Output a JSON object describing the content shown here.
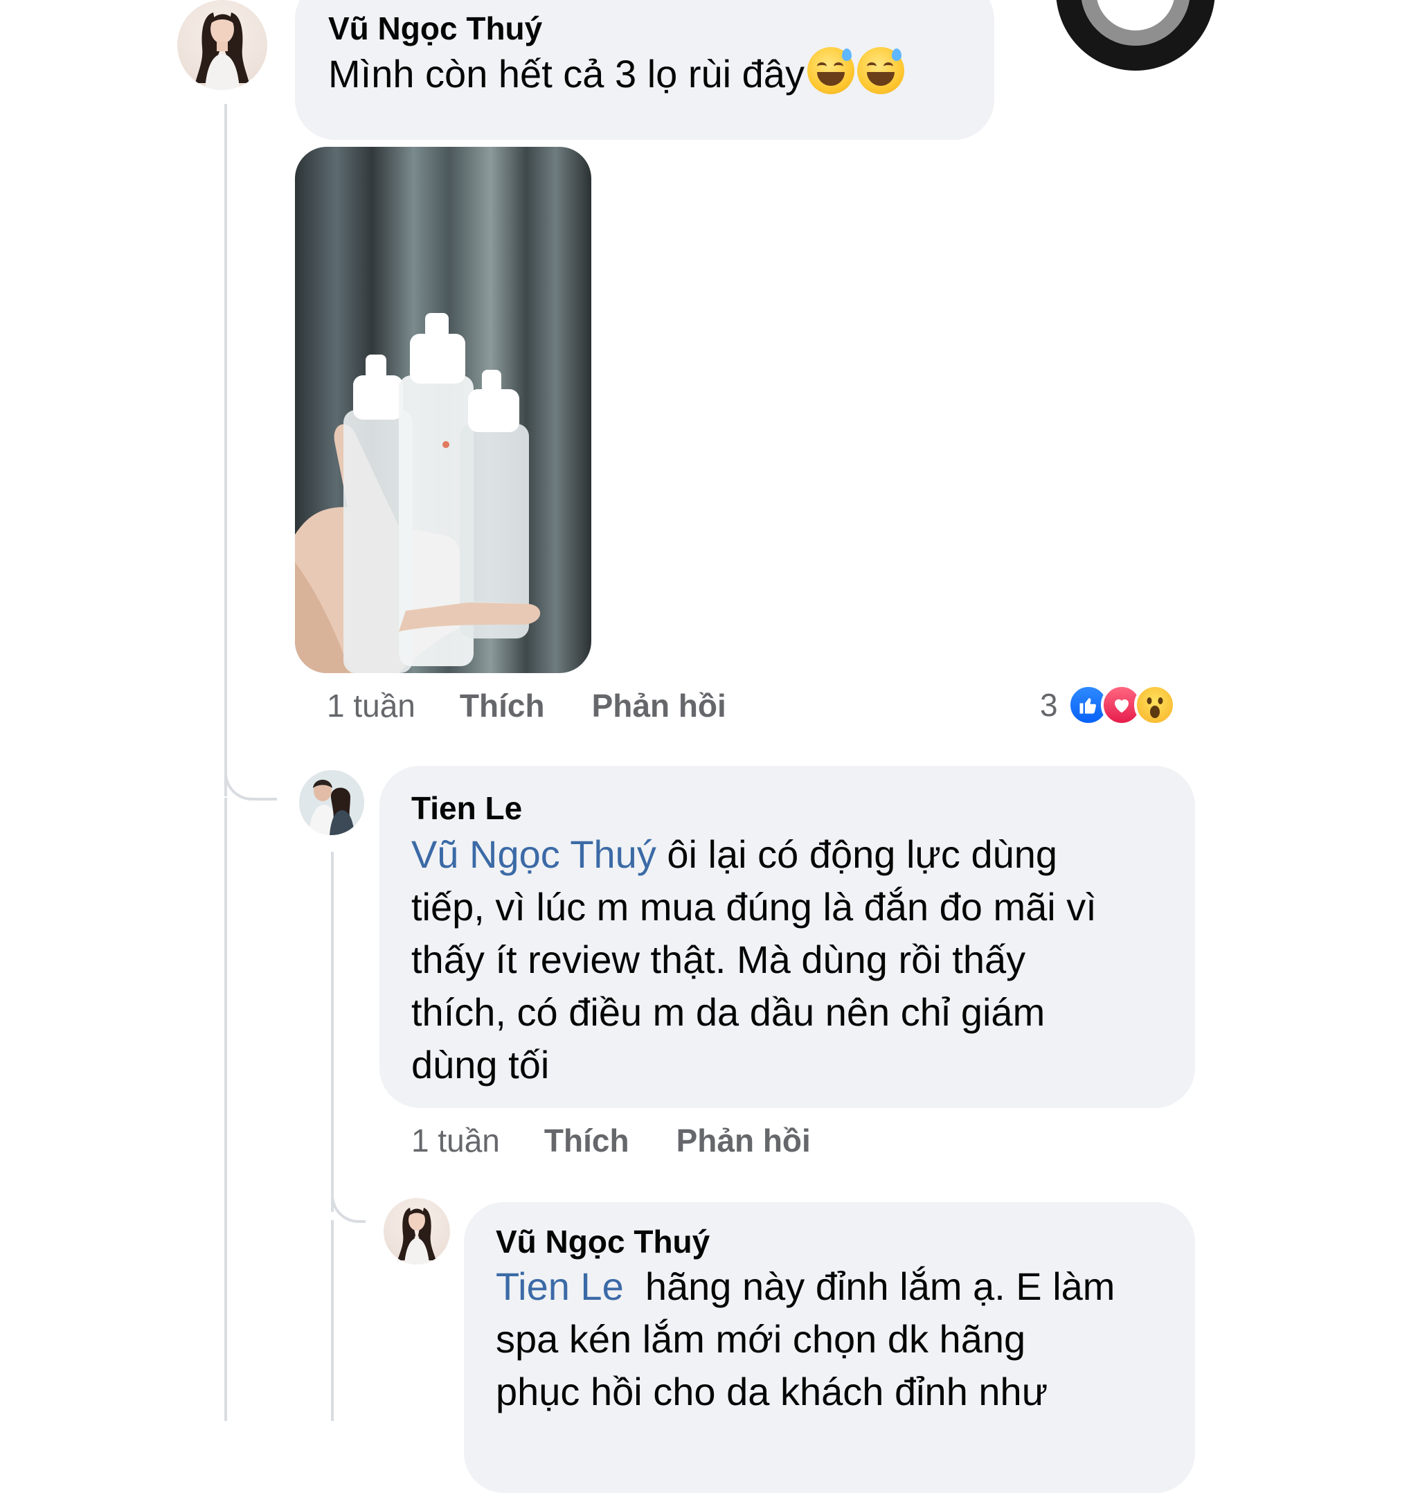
{
  "comment1": {
    "author": "Vũ Ngọc Thuý",
    "text": "Mình còn hết cả 3 lọ rùi đây",
    "emojis": [
      "grinning-sweat-emoji",
      "grinning-sweat-emoji"
    ],
    "time": "1 tuần",
    "like_label": "Thích",
    "reply_label": "Phản hồi",
    "reaction_count": "3",
    "reactions": [
      "like-icon",
      "love-icon",
      "wow-icon"
    ]
  },
  "reply1": {
    "author": "Tien Le",
    "mention": "Vũ Ngọc Thuý",
    "text_line1": " ôi lại có động lực dùng",
    "text_line2": "tiếp, vì lúc m mua đúng là đắn đo mãi vì",
    "text_line3": "thấy ít review thật. Mà dùng rồi thấy",
    "text_line4": "thích, có điều m da dầu nên chỉ giám",
    "text_line5": "dùng tối",
    "time": "1 tuần",
    "like_label": "Thích",
    "reply_label": "Phản hồi"
  },
  "reply2": {
    "author": "Vũ Ngọc Thuý",
    "mention": "Tien Le",
    "text_line1": "  hãng này đỉnh lắm ạ. E làm",
    "text_line2": "spa kén lắm mới chọn dk hãng",
    "text_line3": "phục hồi cho da khách đỉnh như"
  },
  "colors": {
    "bubble": "#f0f2f5",
    "mention": "#3b6aa6",
    "meta": "#65676b",
    "like": "#0862f7",
    "love": "#e61e4d",
    "wow": "#f7b125"
  }
}
